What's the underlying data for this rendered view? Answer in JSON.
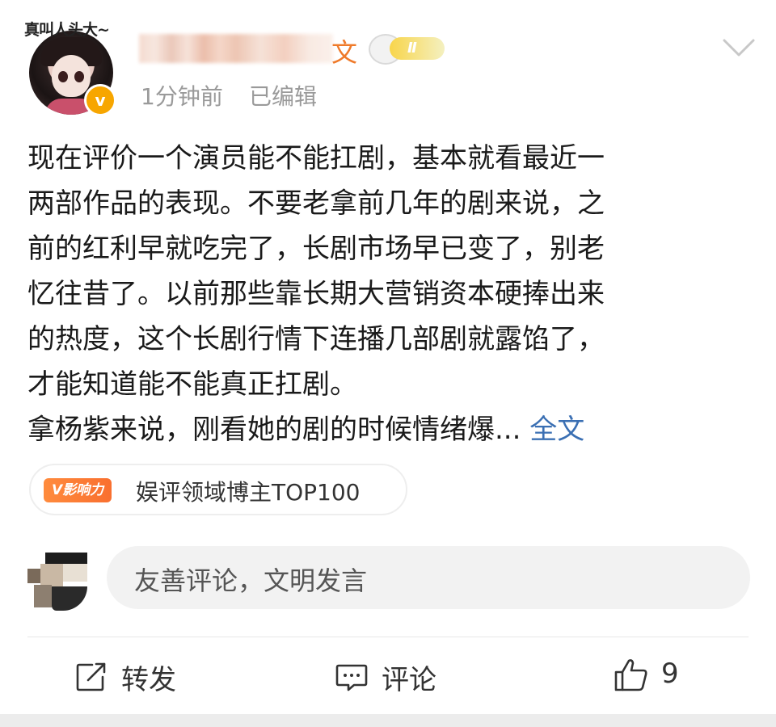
{
  "header": {
    "avatar_caption": "真叫人头大~",
    "username_visible_tail": "文",
    "level_badge": "Ⅱ",
    "verified_mark": "v",
    "timestamp": "1分钟前",
    "edited": "已编辑"
  },
  "post": {
    "lines": [
      "现在评价一个演员能不能扛剧，基本就看最近一",
      "两部作品的表现。不要老拿前几年的剧来说，之",
      "前的红利早就吃完了，长剧市场早已变了，别老",
      "忆往昔了。以前那些靠长期大营销资本硬捧出来",
      "的热度，这个长剧行情下连播几部剧就露馅了，",
      "才能知道能不能真正扛剧。",
      "拿杨紫来说，刚看她的剧的时候情绪爆... "
    ],
    "read_more": "全文"
  },
  "influence": {
    "badge": "V影响力",
    "text": "娱评领域博主TOP100"
  },
  "comment": {
    "placeholder": "友善评论，文明发言"
  },
  "actions": {
    "repost_label": "转发",
    "comment_label": "评论",
    "like_count": "9"
  },
  "colors": {
    "accent_link": "#3a6fb3",
    "verified": "#f7a600",
    "influence": "#f96f2f"
  }
}
